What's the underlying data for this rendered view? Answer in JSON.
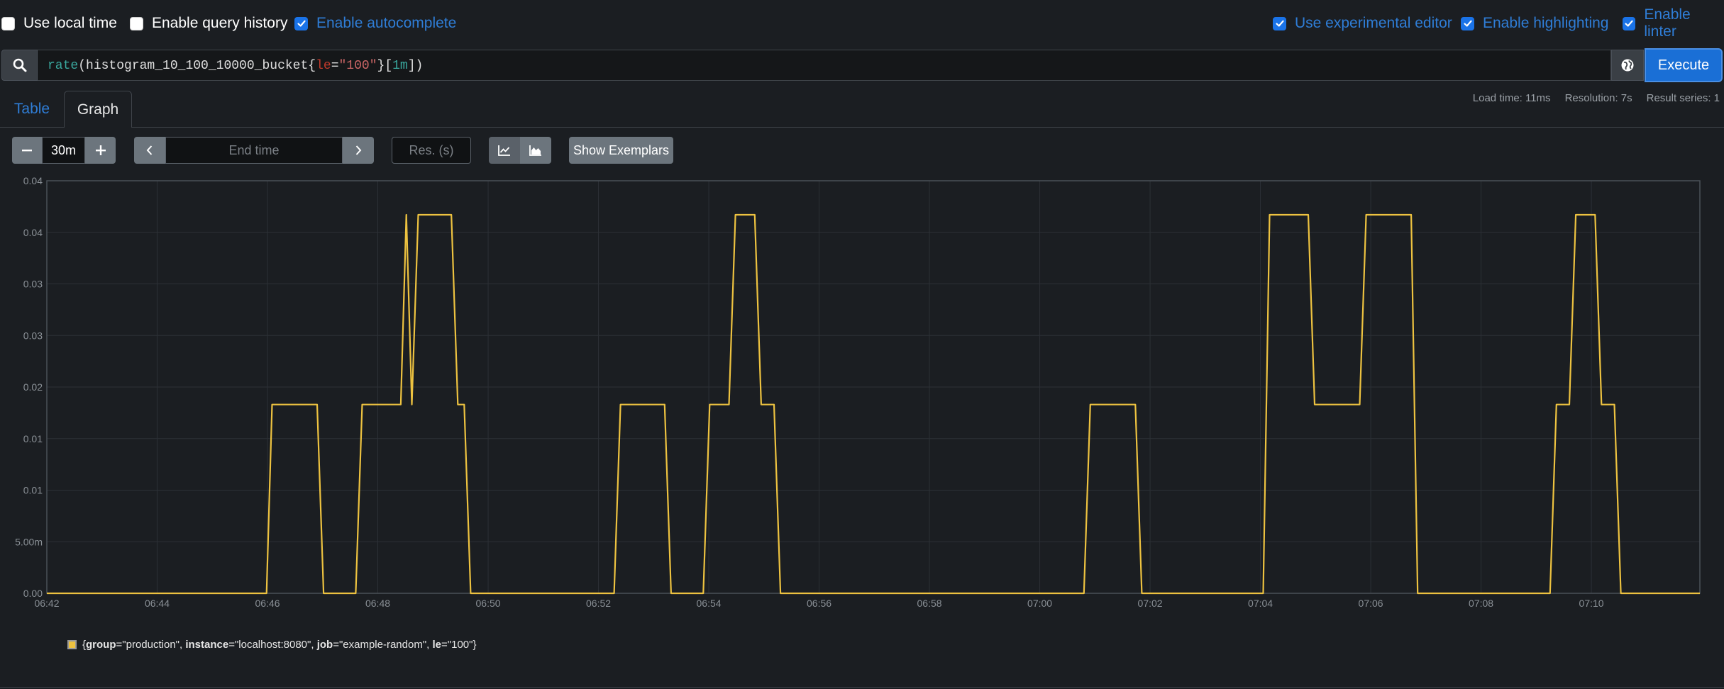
{
  "options": {
    "use_local_time": {
      "label": "Use local time",
      "checked": false
    },
    "enable_query_history": {
      "label": "Enable query history",
      "checked": false
    },
    "enable_autocomplete": {
      "label": "Enable autocomplete",
      "checked": true
    },
    "use_experimental_editor": {
      "label": "Use experimental editor",
      "checked": true
    },
    "enable_highlighting": {
      "label": "Enable highlighting",
      "checked": true
    },
    "enable_linter": {
      "label": "Enable linter",
      "checked": true
    }
  },
  "query": {
    "parts": [
      "rate",
      "(histogram_10_100_10000_bucket{",
      "le",
      "=",
      "\"100\"",
      "}[",
      "1m",
      "])"
    ],
    "execute_label": "Execute"
  },
  "tabs": {
    "table": "Table",
    "graph": "Graph"
  },
  "stats": {
    "load_time": "Load time: 11ms",
    "resolution": "Resolution: 7s",
    "result_series": "Result series: 1"
  },
  "controls": {
    "range_value": "30m",
    "end_time_placeholder": "End time",
    "res_placeholder": "Res. (s)",
    "show_exemplars": "Show Exemplars"
  },
  "chart_data": {
    "type": "line",
    "y_tick_labels": [
      "0.04",
      "0.04",
      "0.03",
      "0.03",
      "0.02",
      "0.01",
      "0.01",
      "5.00m",
      "0.00"
    ],
    "ylim": [
      0,
      0.04
    ],
    "x_tick_labels": [
      "06:42",
      "06:44",
      "06:46",
      "06:48",
      "06:50",
      "06:52",
      "06:54",
      "06:56",
      "06:58",
      "07:00",
      "07:02",
      "07:04",
      "07:06",
      "07:08",
      "07:10"
    ],
    "xlim": [
      "06:42:00",
      "07:11:58"
    ],
    "grid": true,
    "series": [
      {
        "name": "{group=\"production\", instance=\"localhost:8080\", job=\"example-random\", le=\"100\"}",
        "color": "#edc240",
        "points": [
          [
            "06:42:00",
            0
          ],
          [
            "06:45:59",
            0
          ],
          [
            "06:46:05",
            0.0183
          ],
          [
            "06:46:54",
            0.0183
          ],
          [
            "06:47:01",
            0
          ],
          [
            "06:47:36",
            0
          ],
          [
            "06:47:43",
            0.0183
          ],
          [
            "06:48:25",
            0.0183
          ],
          [
            "06:48:31",
            0.0367
          ],
          [
            "06:48:37",
            0.0183
          ],
          [
            "06:48:44",
            0.0367
          ],
          [
            "06:49:20",
            0.0367
          ],
          [
            "06:49:27",
            0.0183
          ],
          [
            "06:49:34",
            0.0183
          ],
          [
            "06:49:41",
            0
          ],
          [
            "06:52:17",
            0
          ],
          [
            "06:52:24",
            0.0183
          ],
          [
            "06:53:12",
            0.0183
          ],
          [
            "06:53:19",
            0
          ],
          [
            "06:53:54",
            0
          ],
          [
            "06:54:01",
            0.0183
          ],
          [
            "06:54:22",
            0.0183
          ],
          [
            "06:54:29",
            0.0367
          ],
          [
            "06:54:50",
            0.0367
          ],
          [
            "06:54:57",
            0.0183
          ],
          [
            "06:55:11",
            0.0183
          ],
          [
            "06:55:18",
            0
          ],
          [
            "07:00:48",
            0
          ],
          [
            "07:00:55",
            0.0183
          ],
          [
            "07:01:44",
            0.0183
          ],
          [
            "07:01:51",
            0
          ],
          [
            "07:04:03",
            0
          ],
          [
            "07:04:10",
            0.0367
          ],
          [
            "07:04:52",
            0.0367
          ],
          [
            "07:04:59",
            0.0183
          ],
          [
            "07:05:48",
            0.0183
          ],
          [
            "07:05:55",
            0.0367
          ],
          [
            "07:06:44",
            0.0367
          ],
          [
            "07:06:51",
            0
          ],
          [
            "07:09:15",
            0
          ],
          [
            "07:09:22",
            0.0183
          ],
          [
            "07:09:36",
            0.0183
          ],
          [
            "07:09:43",
            0.0367
          ],
          [
            "07:10:04",
            0.0367
          ],
          [
            "07:10:11",
            0.0183
          ],
          [
            "07:10:25",
            0.0183
          ],
          [
            "07:10:32",
            0
          ],
          [
            "07:11:58",
            0
          ]
        ]
      }
    ],
    "legend": {
      "labels": [
        {
          "key": "group",
          "value": "\"production\""
        },
        {
          "key": "instance",
          "value": "\"localhost:8080\""
        },
        {
          "key": "job",
          "value": "\"example-random\""
        },
        {
          "key": "le",
          "value": "\"100\""
        }
      ],
      "placement": "bottom-left"
    }
  }
}
